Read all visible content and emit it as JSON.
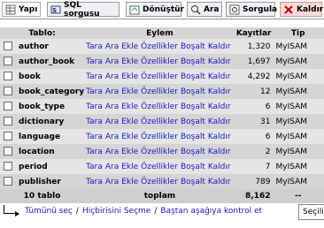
{
  "tabs": [
    {
      "label": "Yapı",
      "icon": "structure-icon",
      "active": true
    },
    {
      "label": "SQL sorgusu",
      "icon": "sql-icon",
      "active": false
    },
    {
      "label": "Dönüştür",
      "icon": "export-icon",
      "active": false
    },
    {
      "label": "Ara",
      "icon": "search-icon",
      "active": false
    },
    {
      "label": "Sorgula",
      "icon": "query-icon",
      "active": false
    },
    {
      "label": "Kaldır",
      "icon": "drop-icon",
      "active": false
    }
  ],
  "table": {
    "headers": {
      "table": "Tablo:",
      "action": "Eylem",
      "rows": "Kayıtlar",
      "type": "Tip"
    },
    "actions": [
      "Tara",
      "Ara",
      "Ekle",
      "Özellikler",
      "Boşalt",
      "Kaldır"
    ],
    "rows": [
      {
        "name": "author",
        "rows": "1,320",
        "type": "MyISAM"
      },
      {
        "name": "author_book",
        "rows": "1,697",
        "type": "MyISAM"
      },
      {
        "name": "book",
        "rows": "4,292",
        "type": "MyISAM"
      },
      {
        "name": "book_category",
        "rows": "12",
        "type": "MyISAM"
      },
      {
        "name": "book_type",
        "rows": "6",
        "type": "MyISAM"
      },
      {
        "name": "dictionary",
        "rows": "31",
        "type": "MyISAM"
      },
      {
        "name": "language",
        "rows": "6",
        "type": "MyISAM"
      },
      {
        "name": "location",
        "rows": "2",
        "type": "MyISAM"
      },
      {
        "name": "period",
        "rows": "7",
        "type": "MyISAM"
      },
      {
        "name": "publisher",
        "rows": "789",
        "type": "MyISAM"
      }
    ],
    "total": {
      "label": "10 tablo",
      "sum_label": "toplam",
      "rows": "8,162",
      "type": "--"
    }
  },
  "footer": {
    "check_all": "Tümünü seç",
    "uncheck_all": "Hiçbirisini Seçme",
    "check_overhead": "Baştan aşağıya kontrol et",
    "sep": "/",
    "select_value": "Seçili"
  }
}
